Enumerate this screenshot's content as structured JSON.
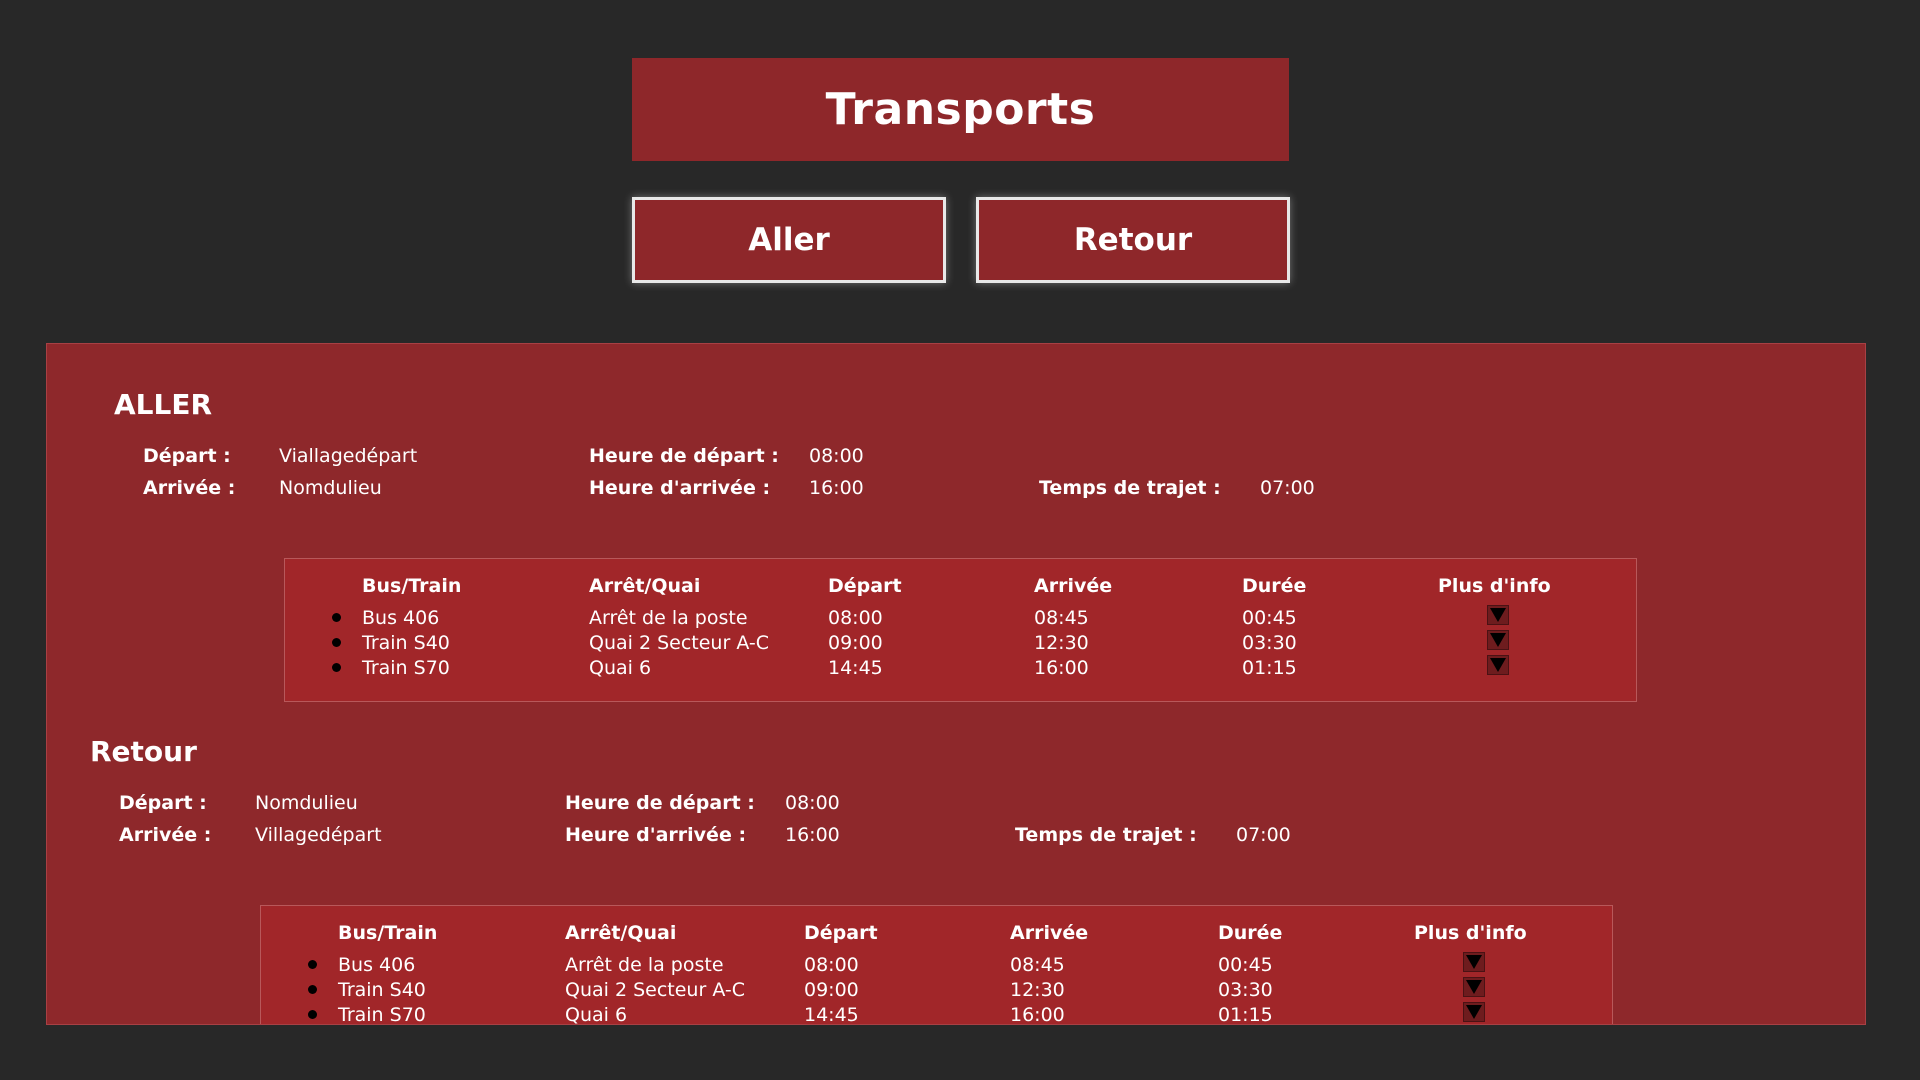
{
  "header": {
    "title": "Transports"
  },
  "nav": {
    "aller_label": "Aller",
    "retour_label": "Retour"
  },
  "aller": {
    "title": "ALLER",
    "depart_label": "Départ :",
    "depart_value": "Viallagedépart",
    "arrivee_label": "Arrivée :",
    "arrivee_value": "Nomdulieu",
    "heure_depart_label": "Heure de départ :",
    "heure_depart_value": "08:00",
    "heure_arrivee_label": "Heure d'arrivée :",
    "heure_arrivee_value": "16:00",
    "temps_label": "Temps de trajet :",
    "temps_value": "07:00",
    "table": {
      "headers": [
        "Bus/Train",
        "Arrêt/Quai",
        "Départ",
        "Arrivée",
        "Durée",
        "Plus d'info"
      ],
      "rows": [
        [
          "Bus 406",
          "Arrêt de la poste",
          "08:00",
          "08:45",
          "00:45"
        ],
        [
          "Train S40",
          "Quai 2 Secteur A-C",
          "09:00",
          "12:30",
          "03:30"
        ],
        [
          "Train S70",
          "Quai 6",
          "14:45",
          "16:00",
          "01:15"
        ]
      ]
    }
  },
  "retour": {
    "title": "Retour",
    "depart_label": "Départ :",
    "depart_value": "Nomdulieu",
    "arrivee_label": "Arrivée :",
    "arrivee_value": "Villagedépart",
    "heure_depart_label": "Heure de départ :",
    "heure_depart_value": "08:00",
    "heure_arrivee_label": "Heure d'arrivée :",
    "heure_arrivee_value": "16:00",
    "temps_label": "Temps de trajet :",
    "temps_value": "07:00",
    "table": {
      "headers": [
        "Bus/Train",
        "Arrêt/Quai",
        "Départ",
        "Arrivée",
        "Durée",
        "Plus d'info"
      ],
      "rows": [
        [
          "Bus 406",
          "Arrêt de la poste",
          "08:00",
          "08:45",
          "00:45"
        ],
        [
          "Train S40",
          "Quai 2 Secteur A-C",
          "09:00",
          "12:30",
          "03:30"
        ],
        [
          "Train S70",
          "Quai 6",
          "14:45",
          "16:00",
          "01:15"
        ]
      ]
    }
  },
  "colors": {
    "background": "#282828",
    "accent": "#8e272a",
    "table_bg": "#a12629"
  },
  "icons": {
    "more_info": "caret-down-icon",
    "row_marker": "bullet-icon"
  }
}
